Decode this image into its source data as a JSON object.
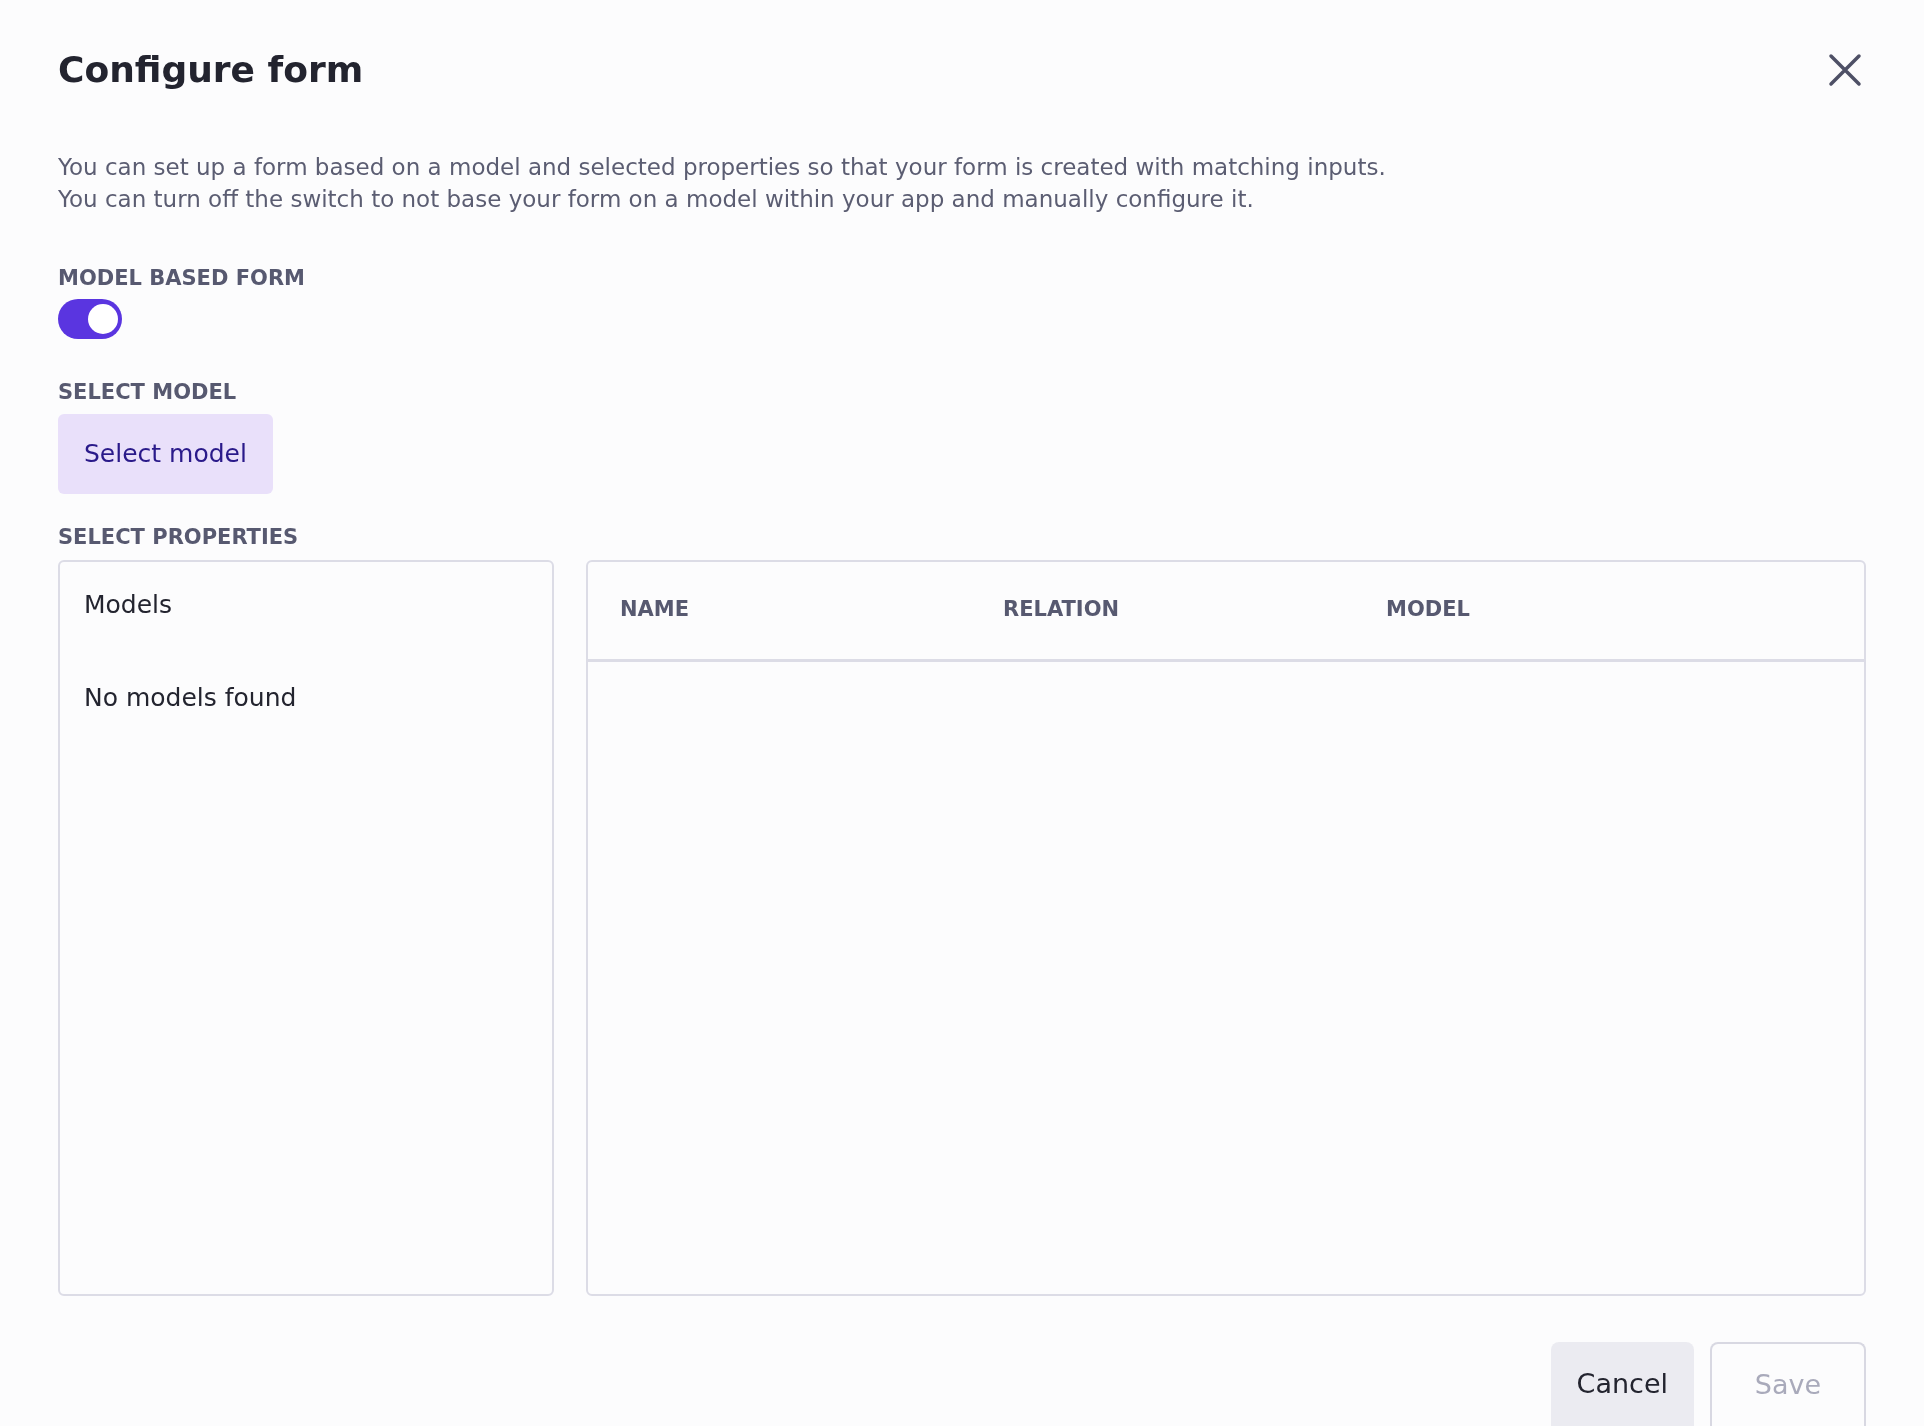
{
  "dialog": {
    "title": "Configure form",
    "description": [
      "You can set up a form based on a model and selected properties so that your form is created with matching inputs.",
      "You can turn off the switch to not base your form on a model within your app and manually configure it."
    ],
    "model_based_form": {
      "label": "MODEL BASED FORM",
      "on": true
    },
    "select_model": {
      "label": "SELECT MODEL",
      "button": "Select model"
    },
    "select_properties": {
      "label": "SELECT PROPERTIES",
      "models_panel": {
        "title": "Models",
        "empty_text": "No models found"
      },
      "table": {
        "columns": [
          "NAME",
          "RELATION",
          "MODEL"
        ]
      }
    },
    "buttons": [
      {
        "label": "Cancel",
        "kind": "secondary",
        "disabled": false
      },
      {
        "label": "Save",
        "kind": "primary",
        "disabled": true
      }
    ]
  }
}
